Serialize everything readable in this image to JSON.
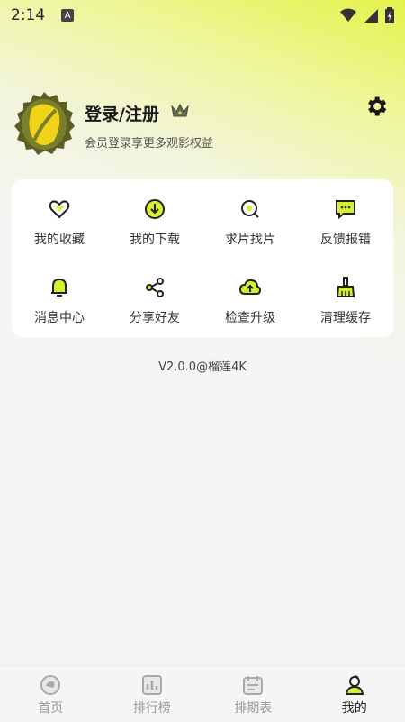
{
  "status": {
    "time": "2:14",
    "a_badge": "A"
  },
  "profile": {
    "title": "登录/注册",
    "subtitle": "会员登录享更多观影权益"
  },
  "menu": [
    {
      "label": "我的收藏",
      "icon": "heart-icon"
    },
    {
      "label": "我的下载",
      "icon": "download-icon"
    },
    {
      "label": "求片找片",
      "icon": "search-film-icon"
    },
    {
      "label": "反馈报错",
      "icon": "feedback-icon"
    },
    {
      "label": "消息中心",
      "icon": "bell-icon"
    },
    {
      "label": "分享好友",
      "icon": "share-icon"
    },
    {
      "label": "检查升级",
      "icon": "upgrade-icon"
    },
    {
      "label": "清理缓存",
      "icon": "broom-icon"
    }
  ],
  "version": "V2.0.0@榴莲4K",
  "nav": [
    {
      "label": "首页",
      "icon": "home-icon"
    },
    {
      "label": "排行榜",
      "icon": "ranking-icon"
    },
    {
      "label": "排期表",
      "icon": "calendar-icon"
    },
    {
      "label": "我的",
      "icon": "profile-icon"
    }
  ],
  "colors": {
    "accent": "#d6ef2e",
    "text": "#222222",
    "muted": "#999999"
  }
}
